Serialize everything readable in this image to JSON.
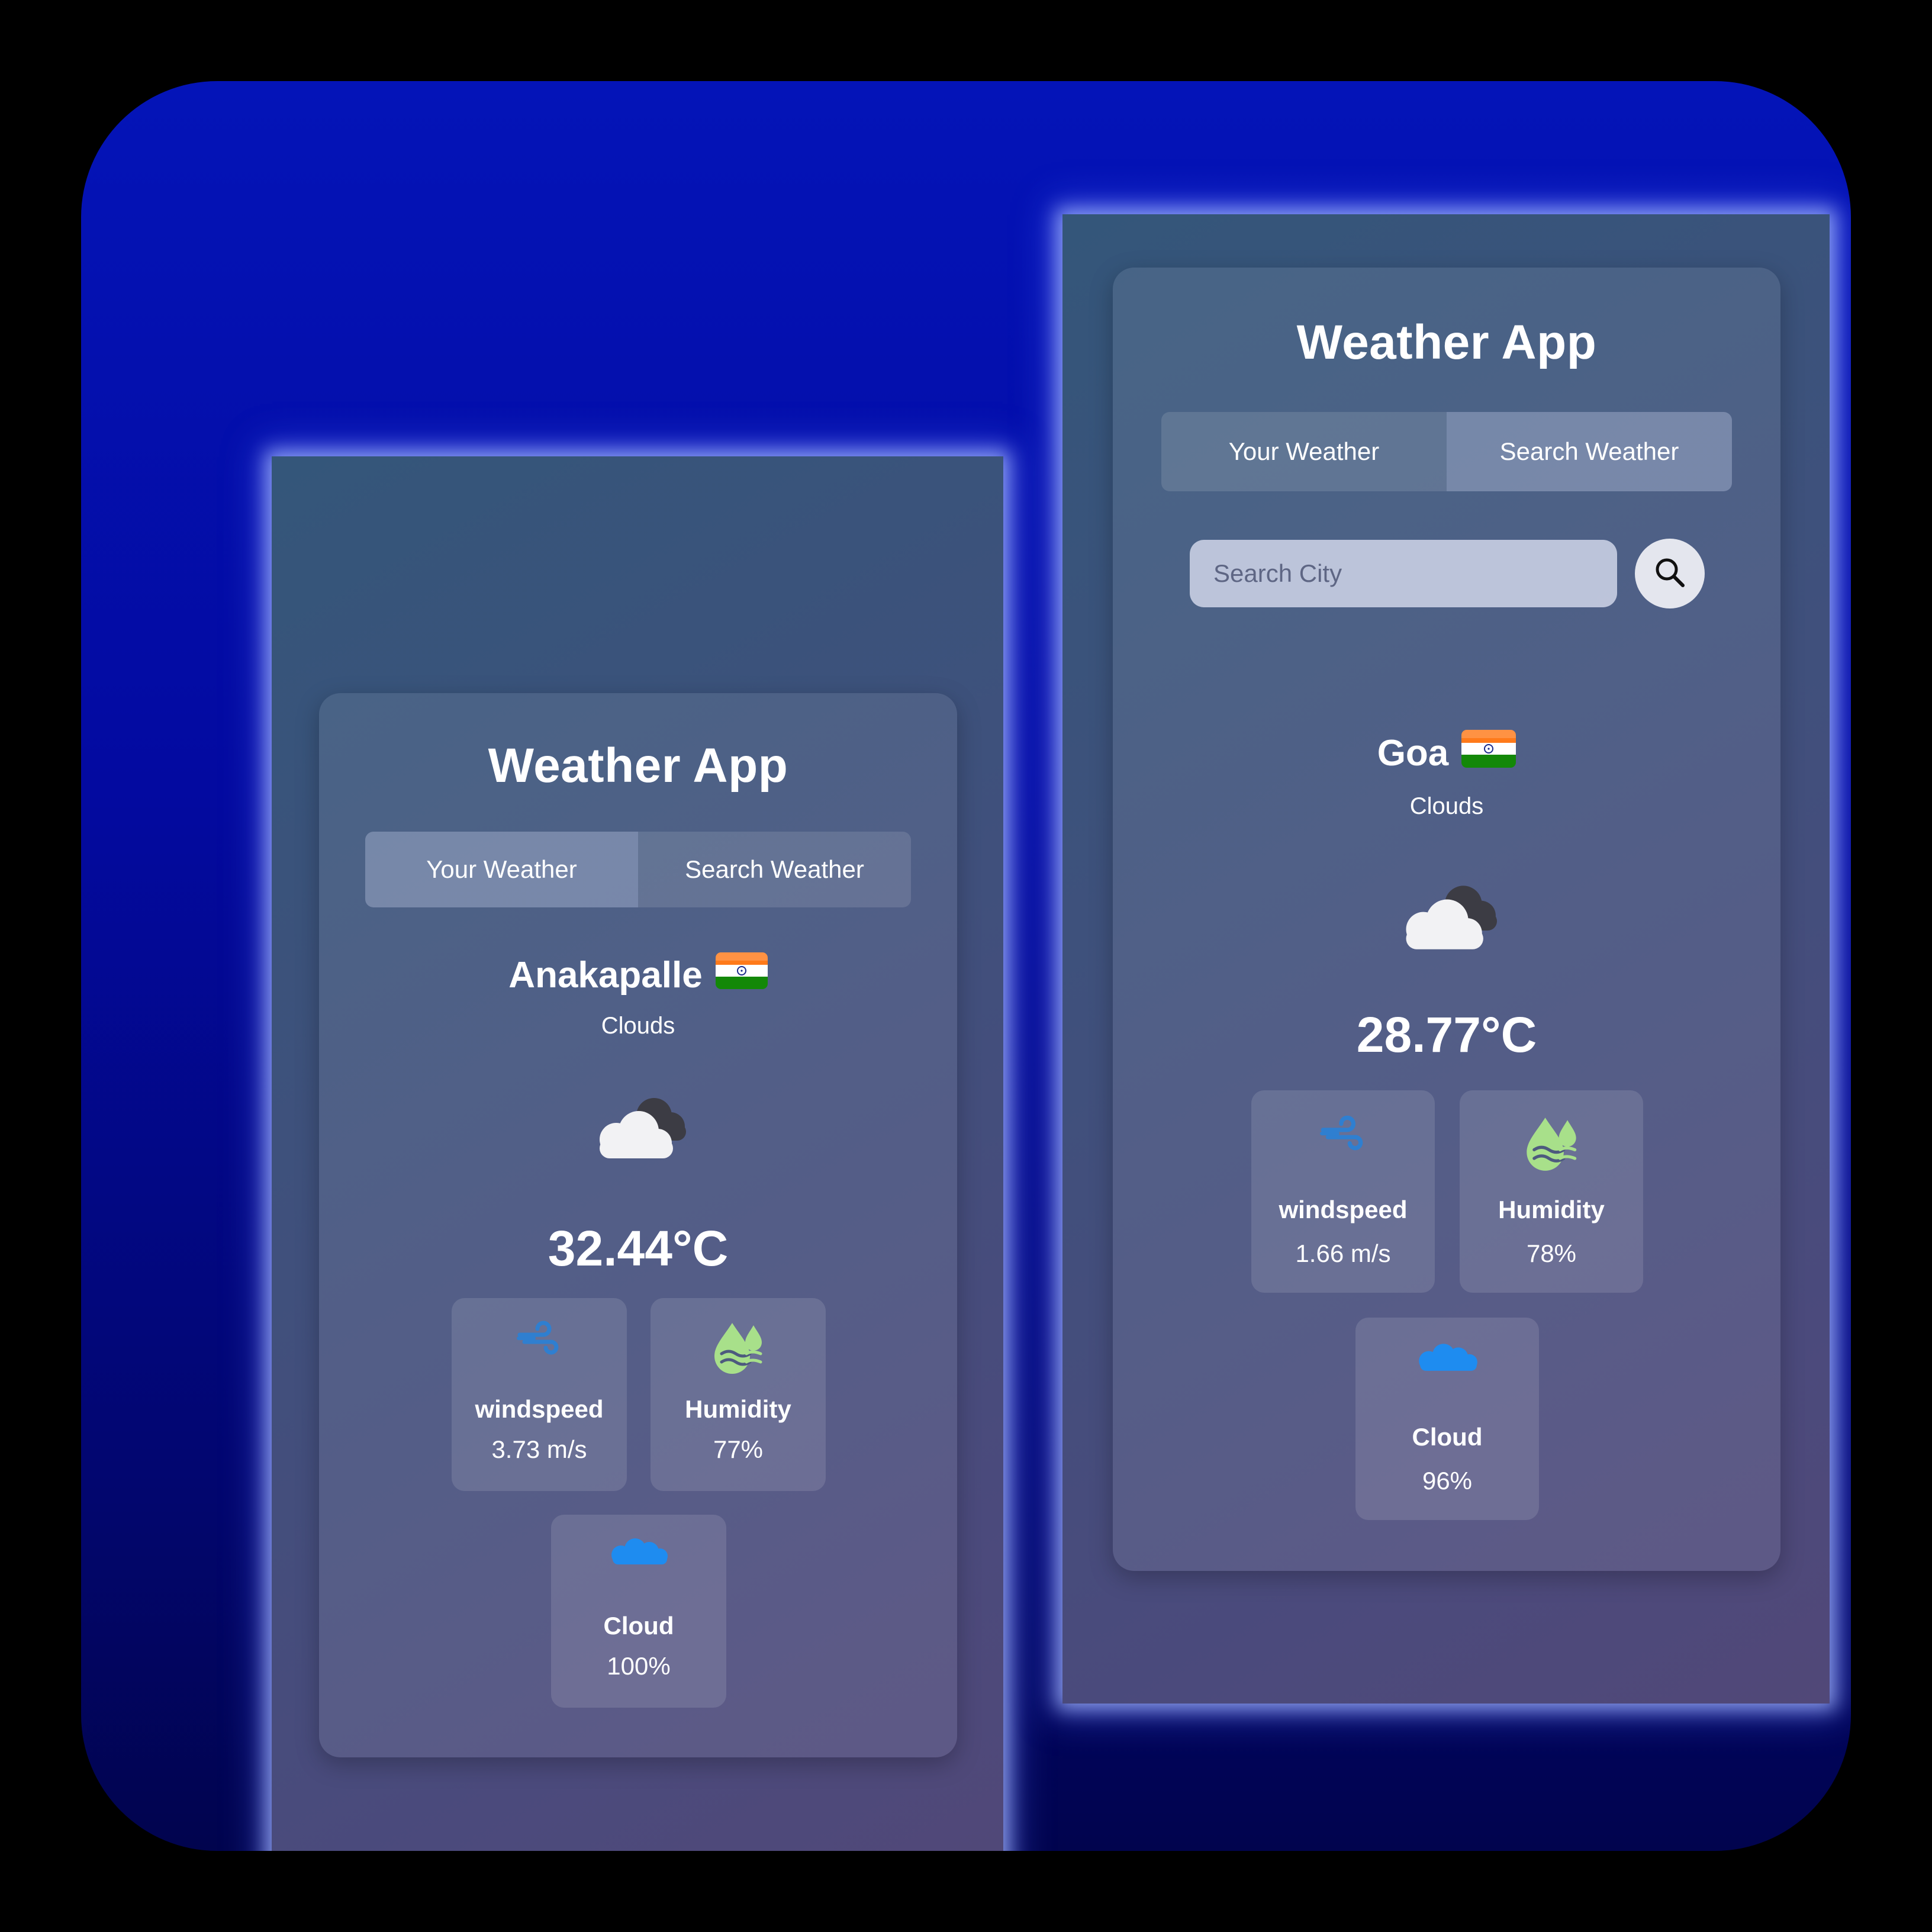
{
  "left_screen": {
    "title": "Weather App",
    "tabs": [
      {
        "label": "Your Weather",
        "active": true
      },
      {
        "label": "Search Weather",
        "active": false
      }
    ],
    "city": "Anakapalle",
    "country_flag": "india-flag-icon",
    "description": "Clouds",
    "weather_icon": "cloudy-icon",
    "temperature": "32.44°C",
    "stats": {
      "windspeed": {
        "label": "windspeed",
        "value": "3.73 m/s",
        "icon": "wind-icon"
      },
      "humidity": {
        "label": "Humidity",
        "value": "77%",
        "icon": "humidity-drop-icon"
      },
      "cloud": {
        "label": "Cloud",
        "value": "100%",
        "icon": "cloud-icon"
      }
    }
  },
  "right_screen": {
    "title": "Weather App",
    "tabs": [
      {
        "label": "Your Weather",
        "active": false
      },
      {
        "label": "Search Weather",
        "active": true
      }
    ],
    "search": {
      "placeholder": "Search City",
      "value": "",
      "button_icon": "search-icon"
    },
    "city": "Goa",
    "country_flag": "india-flag-icon",
    "description": "Clouds",
    "weather_icon": "cloudy-icon",
    "temperature": "28.77°C",
    "stats": {
      "windspeed": {
        "label": "windspeed",
        "value": "1.66 m/s",
        "icon": "wind-icon"
      },
      "humidity": {
        "label": "Humidity",
        "value": "78%",
        "icon": "humidity-drop-icon"
      },
      "cloud": {
        "label": "Cloud",
        "value": "96%",
        "icon": "cloud-icon"
      }
    }
  },
  "colors": {
    "frame_top": "#0414b8",
    "frame_bottom": "#01044e",
    "wind_icon": "#2f7fd0",
    "humidity_icon": "#a8e08a",
    "cloud_icon": "#1e8cf0",
    "flag_saffron": "#ff7a1a",
    "flag_green": "#138808",
    "flag_chakra": "#1a2a8a"
  }
}
